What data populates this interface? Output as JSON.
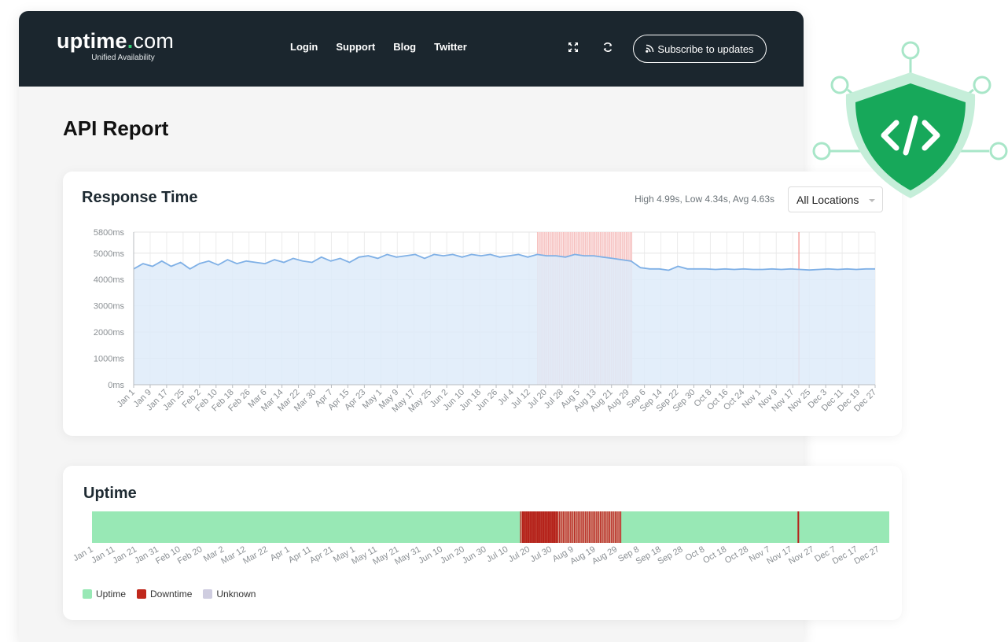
{
  "header": {
    "logo_main": "uptime",
    "logo_dot": ".",
    "logo_suffix": "com",
    "logo_sub": "Unified Availability",
    "nav": [
      "Login",
      "Support",
      "Blog",
      "Twitter"
    ],
    "subscribe_label": "Subscribe to updates",
    "icons": [
      "fullscreen-icon",
      "refresh-icon",
      "rss-icon"
    ]
  },
  "page": {
    "title": "API Report"
  },
  "response_card": {
    "title": "Response Time",
    "stats": "High 4.99s, Low 4.34s, Avg 4.63s",
    "location_select": "All Locations"
  },
  "uptime_card": {
    "title": "Uptime",
    "legend": [
      {
        "label": "Uptime",
        "color": "#98e8b5"
      },
      {
        "label": "Downtime",
        "color": "#c0281c"
      },
      {
        "label": "Unknown",
        "color": "#cfcde0"
      }
    ]
  },
  "colors": {
    "nav_bg": "#1b262e",
    "brand_green": "#2ecc71",
    "area_fill": "#deebf9",
    "area_line": "#7fb0e6",
    "downtime_band": "#f4b9b8",
    "uptime_green": "#98e8b5",
    "downtime_red": "#c0281c",
    "shield_green": "#17a85a"
  },
  "chart_data": [
    {
      "type": "area",
      "title": "Response Time",
      "y_ticks": [
        "5800ms",
        "5000ms",
        "4000ms",
        "3000ms",
        "2000ms",
        "1000ms",
        "0ms"
      ],
      "y_tick_values": [
        5800,
        5000,
        4000,
        3000,
        2000,
        1000,
        0
      ],
      "ylim": [
        0,
        5800
      ],
      "x_ticks": [
        "Jan 1",
        "Jan 9",
        "Jan 17",
        "Jan 25",
        "Feb 2",
        "Feb 10",
        "Feb 18",
        "Feb 26",
        "Mar 6",
        "Mar 14",
        "Mar 22",
        "Mar 30",
        "Apr 7",
        "Apr 15",
        "Apr 23",
        "May 1",
        "May 9",
        "May 17",
        "May 25",
        "Jun 2",
        "Jun 10",
        "Jun 18",
        "Jun 26",
        "Jul 4",
        "Jul 12",
        "Jul 20",
        "Jul 28",
        "Aug 5",
        "Aug 13",
        "Aug 21",
        "Aug 29",
        "Sep 6",
        "Sep 14",
        "Sep 22",
        "Sep 30",
        "Oct 8",
        "Oct 16",
        "Oct 24",
        "Nov 1",
        "Nov 9",
        "Nov 17",
        "Nov 25",
        "Dec 3",
        "Dec 11",
        "Dec 19",
        "Dec 27"
      ],
      "series": [
        {
          "values_ms": [
            4400,
            4600,
            4500,
            4700,
            4500,
            4650,
            4400,
            4600,
            4700,
            4550,
            4750,
            4600,
            4700,
            4650,
            4600,
            4750,
            4650,
            4800,
            4700,
            4650,
            4850,
            4700,
            4800,
            4650,
            4850,
            4900,
            4800,
            4950,
            4850,
            4900,
            4950,
            4800,
            4950,
            4900,
            4950,
            4850,
            4950,
            4900,
            4950,
            4850,
            4900,
            4950,
            4850,
            4950,
            4900,
            4900,
            4850,
            4950,
            4900,
            4900,
            4850,
            4800,
            4750,
            4700,
            4450,
            4400,
            4400,
            4350,
            4500,
            4400,
            4400,
            4400,
            4380,
            4400,
            4380,
            4400,
            4380,
            4380,
            4400,
            4380,
            4400,
            4380,
            4360,
            4380,
            4400,
            4380,
            4400,
            4380,
            4400,
            4400
          ],
          "color": "#7fb0e6"
        }
      ],
      "downtime_ranges": [
        [
          "Jul 16",
          "Aug 31"
        ],
        [
          "Nov 20",
          "Nov 20"
        ]
      ],
      "grid": true
    },
    {
      "type": "bar",
      "title": "Uptime",
      "x_ticks": [
        "Jan 1",
        "Jan 11",
        "Jan 21",
        "Jan 31",
        "Feb 10",
        "Feb 20",
        "Mar 2",
        "Mar 12",
        "Mar 22",
        "Apr 1",
        "Apr 11",
        "Apr 21",
        "May 1",
        "May 11",
        "May 21",
        "May 31",
        "Jun 10",
        "Jun 20",
        "Jun 30",
        "Jul 10",
        "Jul 20",
        "Jul 30",
        "Aug 9",
        "Aug 19",
        "Aug 29",
        "Sep 8",
        "Sep 18",
        "Sep 28",
        "Oct 8",
        "Oct 18",
        "Oct 28",
        "Nov 7",
        "Nov 17",
        "Nov 27",
        "Dec 7",
        "Dec 17",
        "Dec 27"
      ],
      "downtime_ranges": [
        [
          "Jul 16",
          "Aug 31"
        ],
        [
          "Nov 20",
          "Nov 20"
        ]
      ],
      "states": [
        "Uptime",
        "Downtime",
        "Unknown"
      ]
    }
  ]
}
